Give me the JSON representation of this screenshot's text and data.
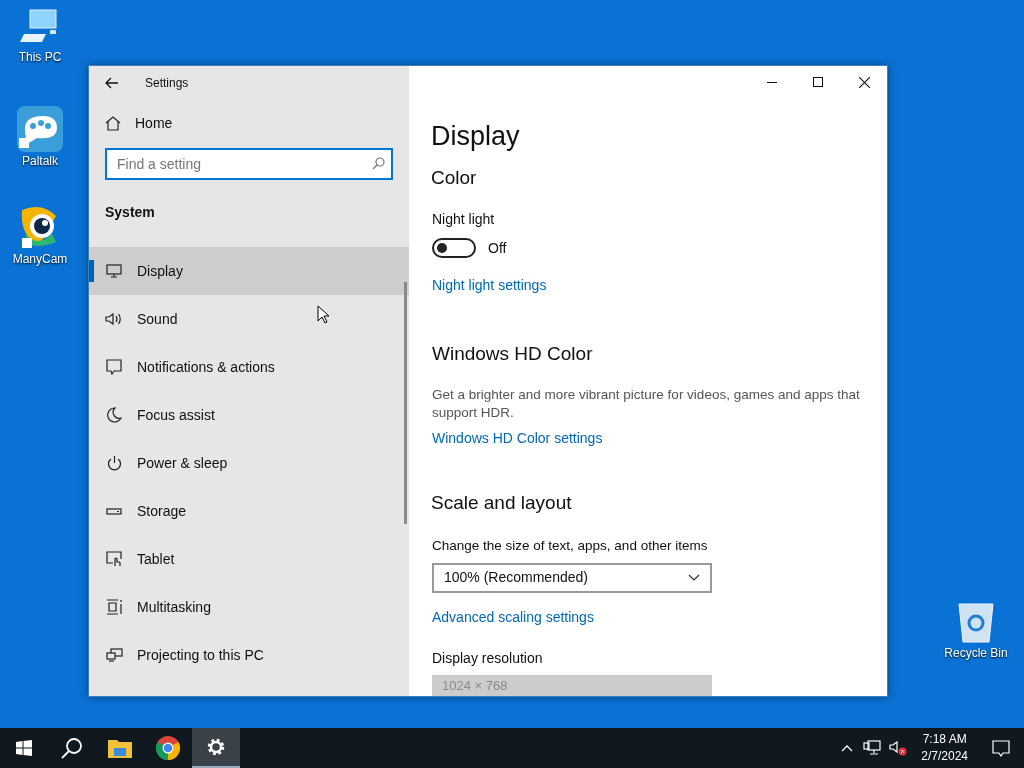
{
  "desktop_icons": [
    {
      "label": "This PC"
    },
    {
      "label": "Paltalk"
    },
    {
      "label": "ManyCam"
    },
    {
      "label": "Recycle Bin"
    }
  ],
  "window": {
    "title": "Settings",
    "home": "Home",
    "search": {
      "placeholder": "Find a setting"
    },
    "section": "System",
    "sidebar": {
      "items": [
        {
          "label": "Display",
          "selected": true
        },
        {
          "label": "Sound",
          "selected": false
        },
        {
          "label": "Notifications & actions",
          "selected": false
        },
        {
          "label": "Focus assist",
          "selected": false
        },
        {
          "label": "Power & sleep",
          "selected": false
        },
        {
          "label": "Storage",
          "selected": false
        },
        {
          "label": "Tablet",
          "selected": false
        },
        {
          "label": "Multitasking",
          "selected": false
        },
        {
          "label": "Projecting to this PC",
          "selected": false
        }
      ]
    },
    "page_title": "Display",
    "color": {
      "heading": "Color",
      "night_light": {
        "label": "Night light",
        "on": false,
        "state": "Off"
      },
      "link": "Night light settings"
    },
    "hd_color": {
      "heading": "Windows HD Color",
      "description": "Get a brighter and more vibrant picture for videos, games and apps that support HDR.",
      "link": "Windows HD Color settings"
    },
    "scale": {
      "heading": "Scale and layout",
      "size_label": "Change the size of text, apps, and other items",
      "size_value": "100% (Recommended)",
      "link": "Advanced scaling settings",
      "resolution_label": "Display resolution",
      "resolution_value": "1024 × 768",
      "resolution_disabled": true
    }
  },
  "taskbar": {
    "apps": [
      {
        "selected": false
      },
      {
        "selected": false
      },
      {
        "selected": true
      }
    ],
    "time": "7:18 AM",
    "date": "2/7/2024"
  }
}
